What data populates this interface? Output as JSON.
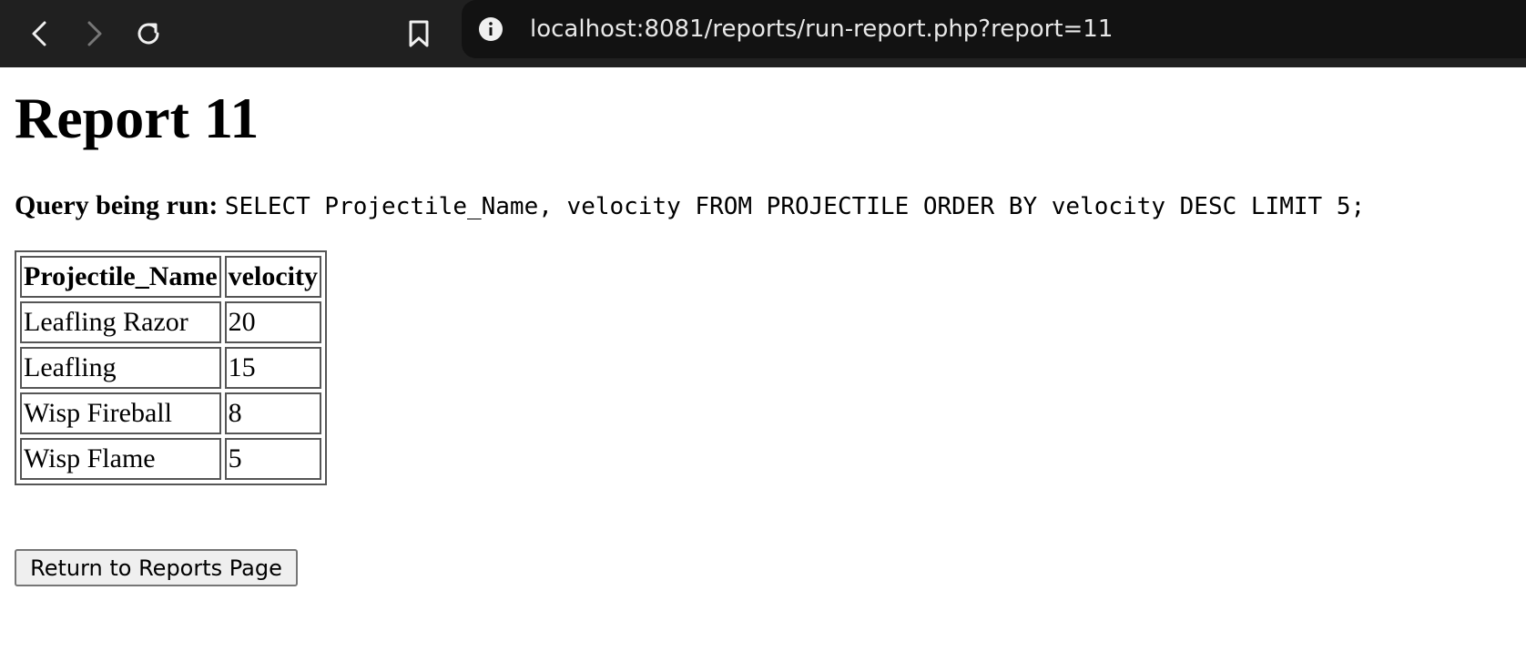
{
  "browser": {
    "url": "localhost:8081/reports/run-report.php?report=11"
  },
  "page": {
    "title": "Report 11",
    "query_label": "Query being run:",
    "query": "SELECT Projectile_Name, velocity FROM PROJECTILE ORDER BY velocity DESC LIMIT 5;"
  },
  "table": {
    "headers": [
      "Projectile_Name",
      "velocity"
    ],
    "rows": [
      [
        "Leafling Razor",
        "20"
      ],
      [
        "Leafling",
        "15"
      ],
      [
        "Wisp Fireball",
        "8"
      ],
      [
        "Wisp Flame",
        "5"
      ]
    ]
  },
  "actions": {
    "return_label": "Return to Reports Page"
  }
}
